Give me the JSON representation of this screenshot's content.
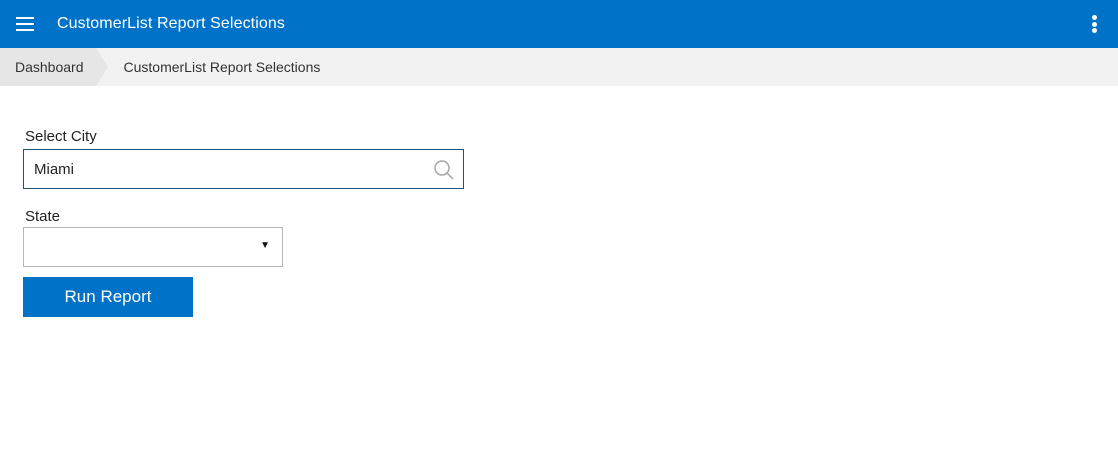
{
  "header": {
    "title": "CustomerList Report Selections",
    "menu_icon": "hamburger-menu-icon",
    "more_icon": "more-vertical-icon",
    "background": "#0073c8"
  },
  "breadcrumb": {
    "home": "Dashboard",
    "current": "CustomerList Report Selections"
  },
  "form": {
    "city": {
      "label": "Select City",
      "value": "Miami",
      "icon": "search-icon"
    },
    "state": {
      "label": "State",
      "value": "",
      "icon": "dropdown-caret-icon"
    },
    "run_button_label": "Run Report"
  },
  "colors": {
    "primary": "#0073c8",
    "breadcrumb_bg": "#f2f2f2",
    "input_border_focus": "#1f5277"
  }
}
